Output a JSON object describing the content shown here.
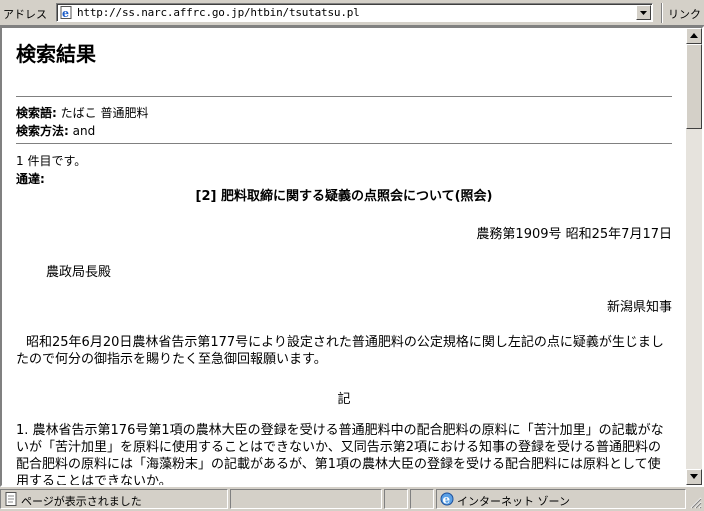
{
  "address_bar": {
    "label": "アドレス",
    "url": "http://ss.narc.affrc.go.jp/htbin/tsutatsu.pl",
    "links_label": "リンク"
  },
  "page": {
    "heading": "検索結果",
    "search_term_label": "検索語:",
    "search_term_value": "たばこ 普通肥料",
    "search_method_label": "検索方法:",
    "search_method_value": "and",
    "result_count": "1 件目です。",
    "notice_label": "通達:",
    "doc_title": "[2] 肥料取締に関する疑義の点照会について(照会)",
    "doc_number_date": "農務第1909号 昭和25年7月17日",
    "addressee": "農政局長殿",
    "sender": "新潟県知事",
    "body_paragraph": "昭和25年6月20日農林省告示第177号により設定された普通肥料の公定規格に関し左記の点に疑義が生じましたので何分の御指示を賜りたく至急御回報願います。",
    "ki": "記",
    "item1": "1. 農林省告示第176号第1項の農林大臣の登録を受ける普通肥料中の配合肥料の原料に「苦汁加里」の記載がないが「苦汁加里」を原料に使用することはできないか、又同告示第2項における知事の登録を受ける普通肥料の配合肥料の原料には「海藻粉末」の記載があるが、第1項の農林大臣の登録を受ける配合肥料には原料として使用することはできないか。"
  },
  "status_bar": {
    "message": "ページが表示されました",
    "zone": "インターネット ゾーン"
  }
}
